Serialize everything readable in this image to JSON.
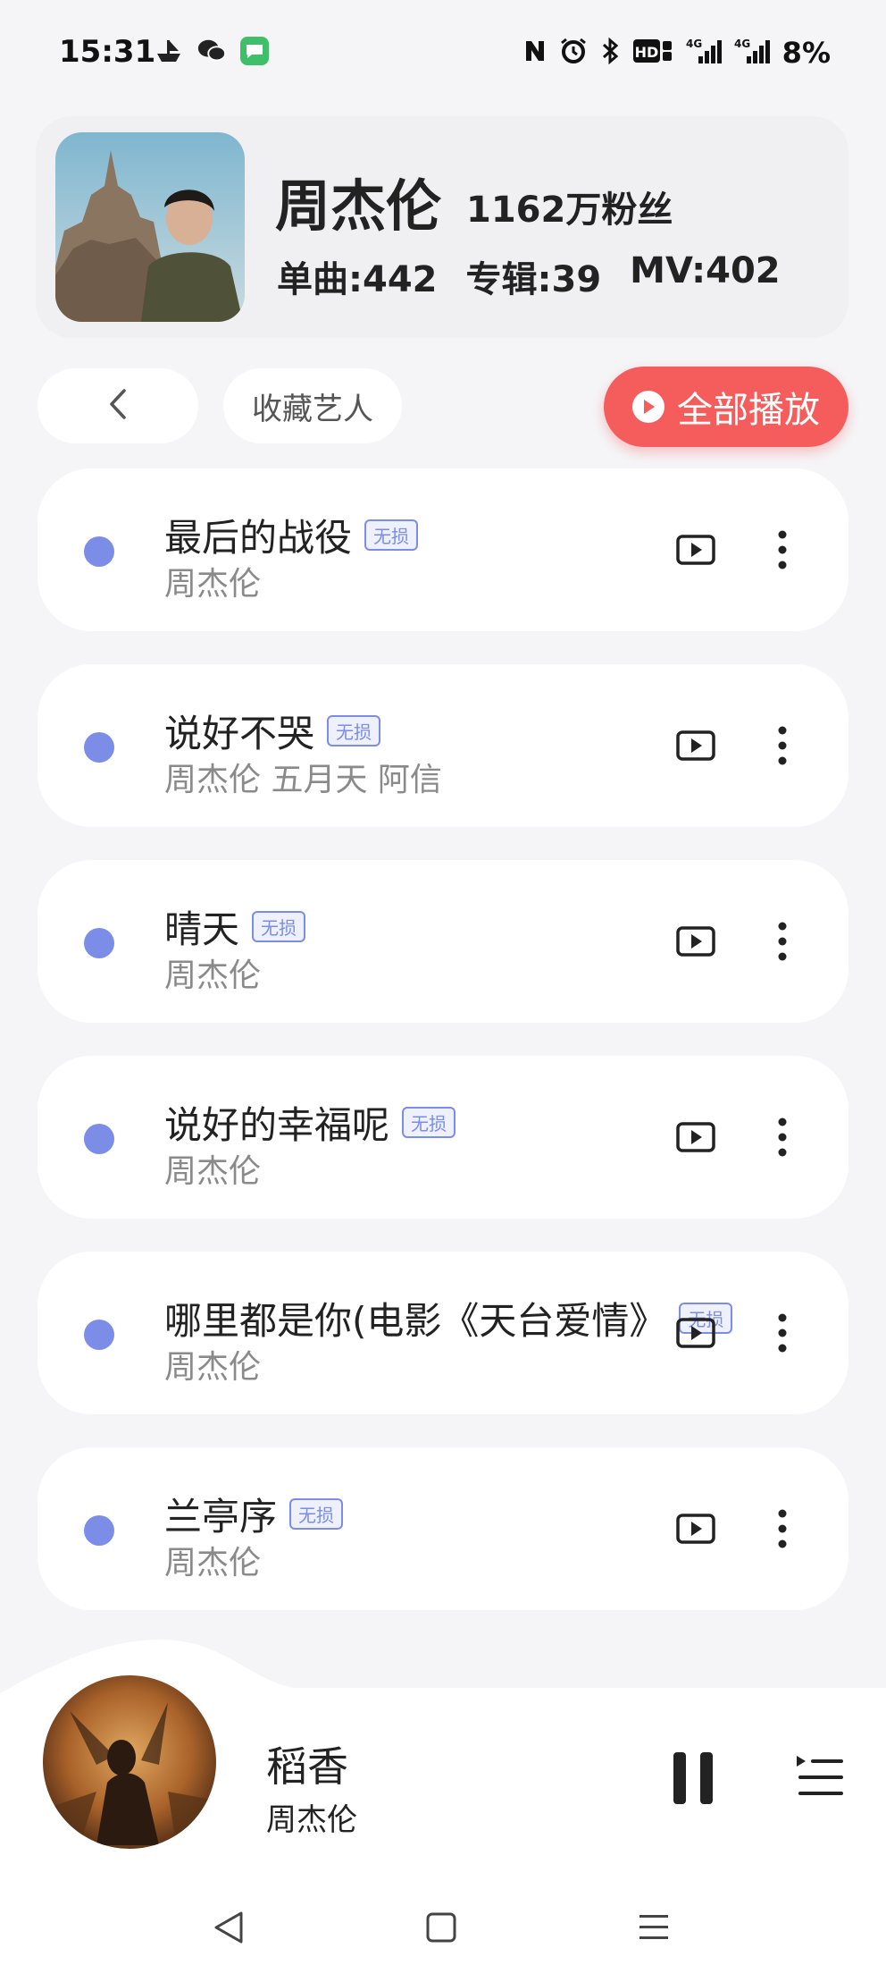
{
  "status_bar": {
    "time": "15:31",
    "icons_left": [
      "boat-icon",
      "wechat-icon",
      "messages-icon"
    ],
    "icons_right": [
      "nfc-icon",
      "alarm-icon",
      "bluetooth-icon",
      "hd-icon",
      "signal-4g-icon",
      "signal-4g-icon"
    ],
    "battery": "8%"
  },
  "artist": {
    "name": "周杰伦",
    "fans": "1162万粉丝",
    "singles": "单曲:442",
    "albums": "专辑:39",
    "mvs": "MV:402"
  },
  "actions": {
    "favorite": "收藏艺人",
    "play_all": "全部播放"
  },
  "songs": [
    {
      "title": "最后的战役",
      "badge": "无损",
      "artist": "周杰伦"
    },
    {
      "title": "说好不哭",
      "badge": "无损",
      "artist": "周杰伦 五月天 阿信"
    },
    {
      "title": "晴天",
      "badge": "无损",
      "artist": "周杰伦"
    },
    {
      "title": "说好的幸福呢",
      "badge": "无损",
      "artist": "周杰伦"
    },
    {
      "title": "哪里都是你(电影《天台爱情》",
      "badge": "无损",
      "artist": "周杰伦"
    },
    {
      "title": "兰亭序",
      "badge": "无损",
      "artist": "周杰伦"
    }
  ],
  "player": {
    "title": "稻香",
    "artist": "周杰伦"
  },
  "colors": {
    "accent": "#f55d5d",
    "dot": "#7b8de6",
    "background": "#f5f5f7"
  }
}
